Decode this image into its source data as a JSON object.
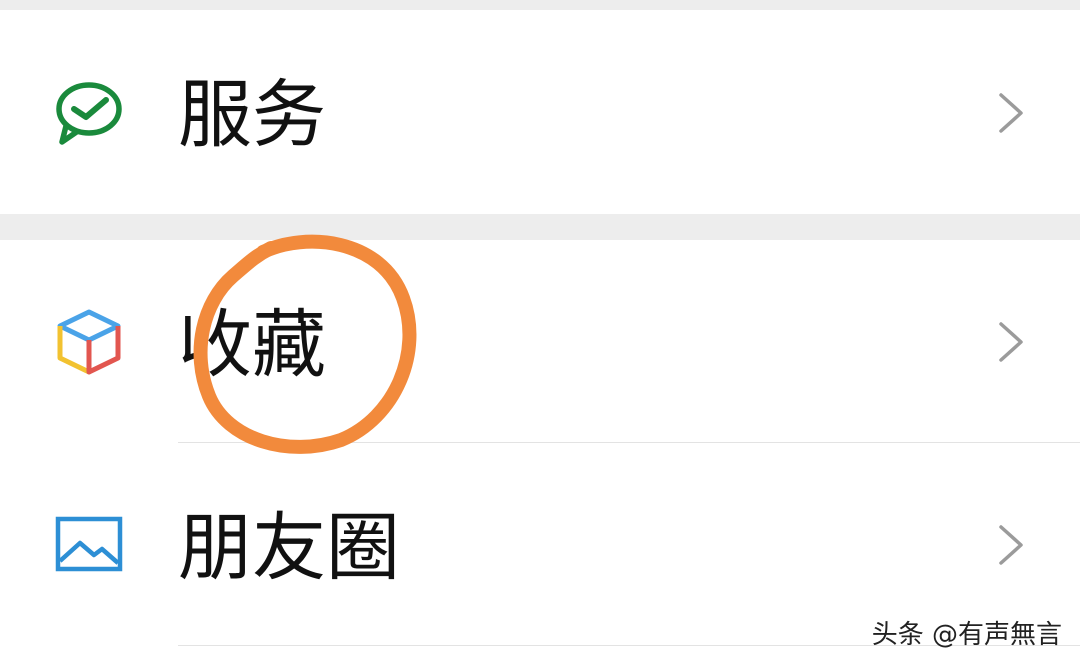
{
  "menu": {
    "items": [
      {
        "label": "服务",
        "icon": "wechat-pay-icon",
        "icon_color": "#1a8a3c"
      },
      {
        "label": "收藏",
        "icon": "favorites-cube-icon",
        "icon_colors": [
          "#4aa3e8",
          "#f2c230",
          "#e2564f"
        ]
      },
      {
        "label": "朋友圈",
        "icon": "moments-image-icon",
        "icon_color": "#2d8fd5"
      }
    ],
    "chevron_icon": "chevron-right-icon",
    "chevron_color": "#9b9b9b"
  },
  "colors": {
    "background": "#ffffff",
    "section_gap": "#ededed",
    "annotation": "#f28a3c"
  },
  "watermark": {
    "text": "头条 @有声無言"
  }
}
